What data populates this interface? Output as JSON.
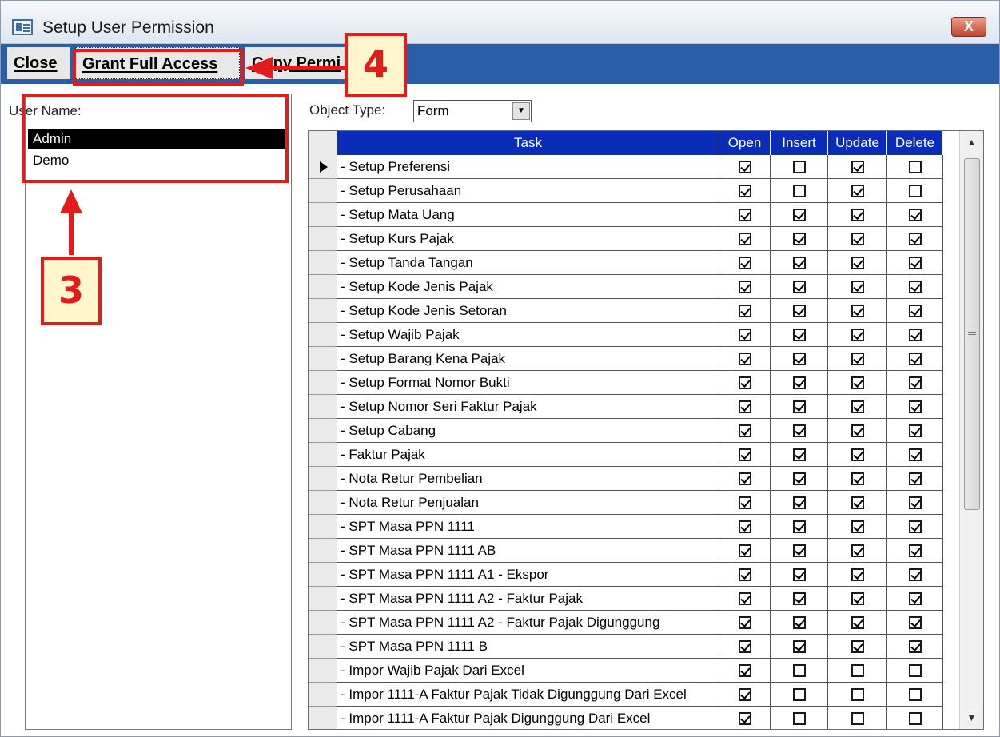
{
  "window": {
    "title": "Setup User Permission",
    "close_glyph": "X"
  },
  "toolbar": {
    "close_label": "Close",
    "grant_label": "Grant Full Access",
    "copy_label": "Copy Permi"
  },
  "users": {
    "label": "User Name:",
    "items": [
      "Admin",
      "Demo"
    ],
    "selected": "Admin"
  },
  "object_type": {
    "label": "Object Type:",
    "value": "Form"
  },
  "grid": {
    "columns": [
      "Task",
      "Open",
      "Insert",
      "Update",
      "Delete"
    ],
    "rows": [
      {
        "task": "- Setup Preferensi",
        "open": true,
        "insert": false,
        "update": true,
        "delete": false
      },
      {
        "task": "- Setup Perusahaan",
        "open": true,
        "insert": false,
        "update": true,
        "delete": false
      },
      {
        "task": "- Setup Mata Uang",
        "open": true,
        "insert": true,
        "update": true,
        "delete": true
      },
      {
        "task": "- Setup Kurs Pajak",
        "open": true,
        "insert": true,
        "update": true,
        "delete": true
      },
      {
        "task": "- Setup Tanda Tangan",
        "open": true,
        "insert": true,
        "update": true,
        "delete": true
      },
      {
        "task": "- Setup Kode Jenis Pajak",
        "open": true,
        "insert": true,
        "update": true,
        "delete": true
      },
      {
        "task": "- Setup Kode Jenis Setoran",
        "open": true,
        "insert": true,
        "update": true,
        "delete": true
      },
      {
        "task": "- Setup Wajib Pajak",
        "open": true,
        "insert": true,
        "update": true,
        "delete": true
      },
      {
        "task": "- Setup Barang Kena Pajak",
        "open": true,
        "insert": true,
        "update": true,
        "delete": true
      },
      {
        "task": "- Setup Format Nomor Bukti",
        "open": true,
        "insert": true,
        "update": true,
        "delete": true
      },
      {
        "task": "- Setup Nomor Seri Faktur Pajak",
        "open": true,
        "insert": true,
        "update": true,
        "delete": true
      },
      {
        "task": "- Setup Cabang",
        "open": true,
        "insert": true,
        "update": true,
        "delete": true
      },
      {
        "task": "- Faktur Pajak",
        "open": true,
        "insert": true,
        "update": true,
        "delete": true
      },
      {
        "task": "- Nota Retur Pembelian",
        "open": true,
        "insert": true,
        "update": true,
        "delete": true
      },
      {
        "task": "- Nota Retur Penjualan",
        "open": true,
        "insert": true,
        "update": true,
        "delete": true
      },
      {
        "task": "- SPT Masa PPN 1111",
        "open": true,
        "insert": true,
        "update": true,
        "delete": true
      },
      {
        "task": "- SPT Masa PPN 1111 AB",
        "open": true,
        "insert": true,
        "update": true,
        "delete": true
      },
      {
        "task": "- SPT Masa PPN 1111 A1 - Ekspor",
        "open": true,
        "insert": true,
        "update": true,
        "delete": true
      },
      {
        "task": "- SPT Masa PPN 1111 A2 - Faktur Pajak",
        "open": true,
        "insert": true,
        "update": true,
        "delete": true
      },
      {
        "task": "- SPT Masa PPN 1111 A2 - Faktur Pajak Digunggung",
        "open": true,
        "insert": true,
        "update": true,
        "delete": true
      },
      {
        "task": "- SPT Masa PPN 1111 B",
        "open": true,
        "insert": true,
        "update": true,
        "delete": true
      },
      {
        "task": "- Impor Wajib Pajak  Dari Excel",
        "open": true,
        "insert": false,
        "update": false,
        "delete": false
      },
      {
        "task": "- Impor 1111-A Faktur Pajak Tidak Digunggung Dari Excel",
        "open": true,
        "insert": false,
        "update": false,
        "delete": false
      },
      {
        "task": "- Impor 1111-A Faktur Pajak Digunggung Dari Excel",
        "open": true,
        "insert": false,
        "update": false,
        "delete": false
      }
    ]
  },
  "annotations": {
    "callout_3": "3",
    "callout_4": "4",
    "color": "#e21b1b"
  },
  "colors": {
    "toolbar_bg": "#2c5ea8",
    "header_bg": "#0a2db7",
    "selected_row_bg": "#000000"
  }
}
